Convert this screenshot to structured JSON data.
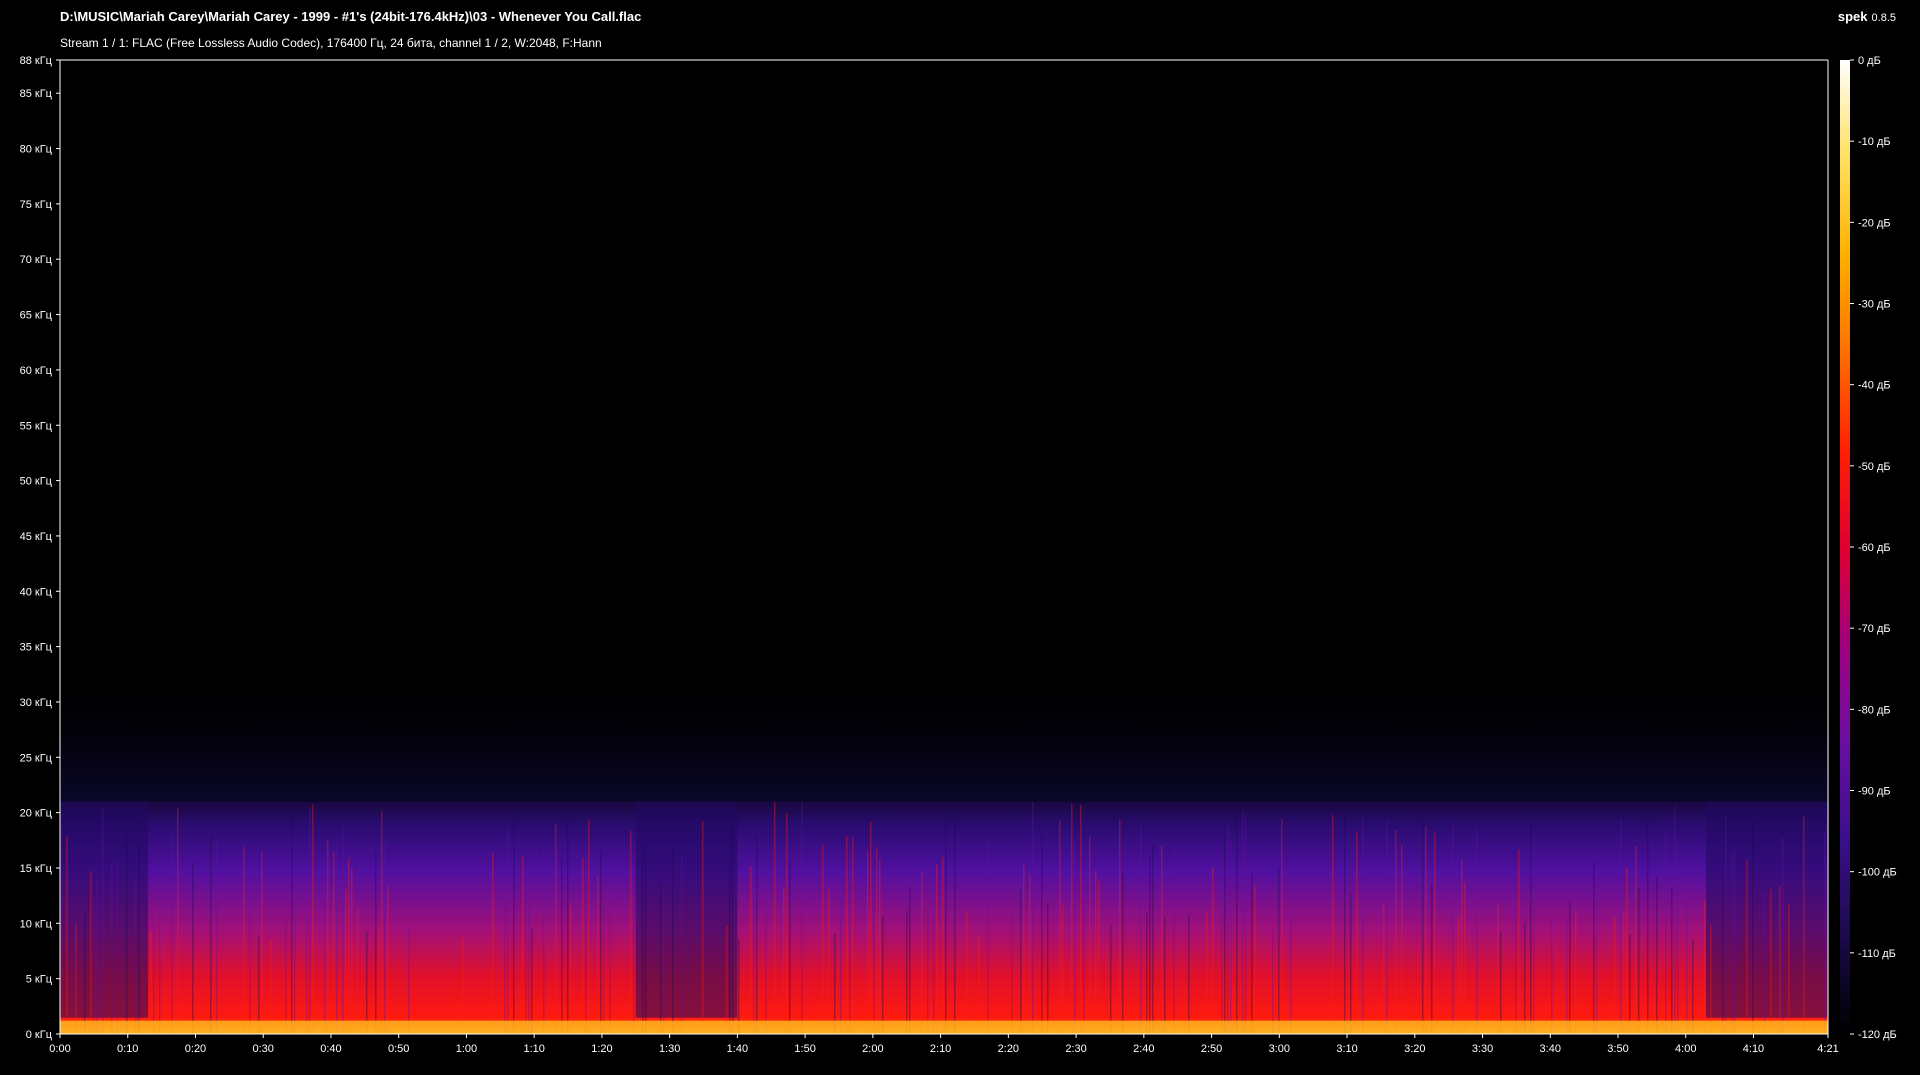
{
  "header": {
    "title": "D:\\MUSIC\\Mariah Carey\\Mariah Carey - 1999 -  #1's (24bit-176.4kHz)\\03 - Whenever You Call.flac",
    "subtitle": "Stream 1 / 1: FLAC (Free Lossless Audio Codec), 176400 Гц, 24 бита, channel 1 / 2, W:2048, F:Hann",
    "app_name": "spek",
    "app_version": "0.8.5"
  },
  "chart_data": {
    "type": "heatmap",
    "x_axis": {
      "unit": "time",
      "range_seconds": [
        0,
        261
      ],
      "ticks": [
        "0:00",
        "0:10",
        "0:20",
        "0:30",
        "0:40",
        "0:50",
        "1:00",
        "1:10",
        "1:20",
        "1:30",
        "1:40",
        "1:50",
        "2:00",
        "2:10",
        "2:20",
        "2:30",
        "2:40",
        "2:50",
        "3:00",
        "3:10",
        "3:20",
        "3:30",
        "3:40",
        "3:50",
        "4:00",
        "4:10",
        "4:21"
      ]
    },
    "y_axis": {
      "unit": "kHz",
      "range": [
        0,
        88
      ],
      "ticks": [
        "0 кГц",
        "5 кГц",
        "10 кГц",
        "15 кГц",
        "20 кГц",
        "25 кГц",
        "30 кГц",
        "35 кГц",
        "40 кГц",
        "45 кГц",
        "50 кГц",
        "55 кГц",
        "60 кГц",
        "65 кГц",
        "70 кГц",
        "75 кГц",
        "80 кГц",
        "85 кГц",
        "88 кГц"
      ],
      "tick_values": [
        0,
        5,
        10,
        15,
        20,
        25,
        30,
        35,
        40,
        45,
        50,
        55,
        60,
        65,
        70,
        75,
        80,
        85,
        88
      ]
    },
    "colorbar": {
      "unit": "dB",
      "range": [
        -120,
        0
      ],
      "ticks": [
        "0 дБ",
        "-10 дБ",
        "-20 дБ",
        "-30 дБ",
        "-40 дБ",
        "-50 дБ",
        "-60 дБ",
        "-70 дБ",
        "-80 дБ",
        "-90 дБ",
        "-100 дБ",
        "-110 дБ",
        "-120 дБ"
      ],
      "tick_values": [
        0,
        -10,
        -20,
        -30,
        -40,
        -50,
        -60,
        -70,
        -80,
        -90,
        -100,
        -110,
        -120
      ],
      "palette": [
        "#000000",
        "#1a0a4a",
        "#3a0f8a",
        "#6a0fa0",
        "#a00080",
        "#e00030",
        "#ff2000",
        "#ff7000",
        "#ffb000",
        "#ffe060",
        "#ffffff"
      ]
    },
    "spectral_cutoff_khz": 21,
    "quiet_sections_seconds": [
      [
        0,
        13
      ],
      [
        85,
        100
      ],
      [
        243,
        261
      ]
    ]
  },
  "colors": {
    "background": "#000000",
    "text": "#ffffff",
    "axis": "#ffffff"
  }
}
